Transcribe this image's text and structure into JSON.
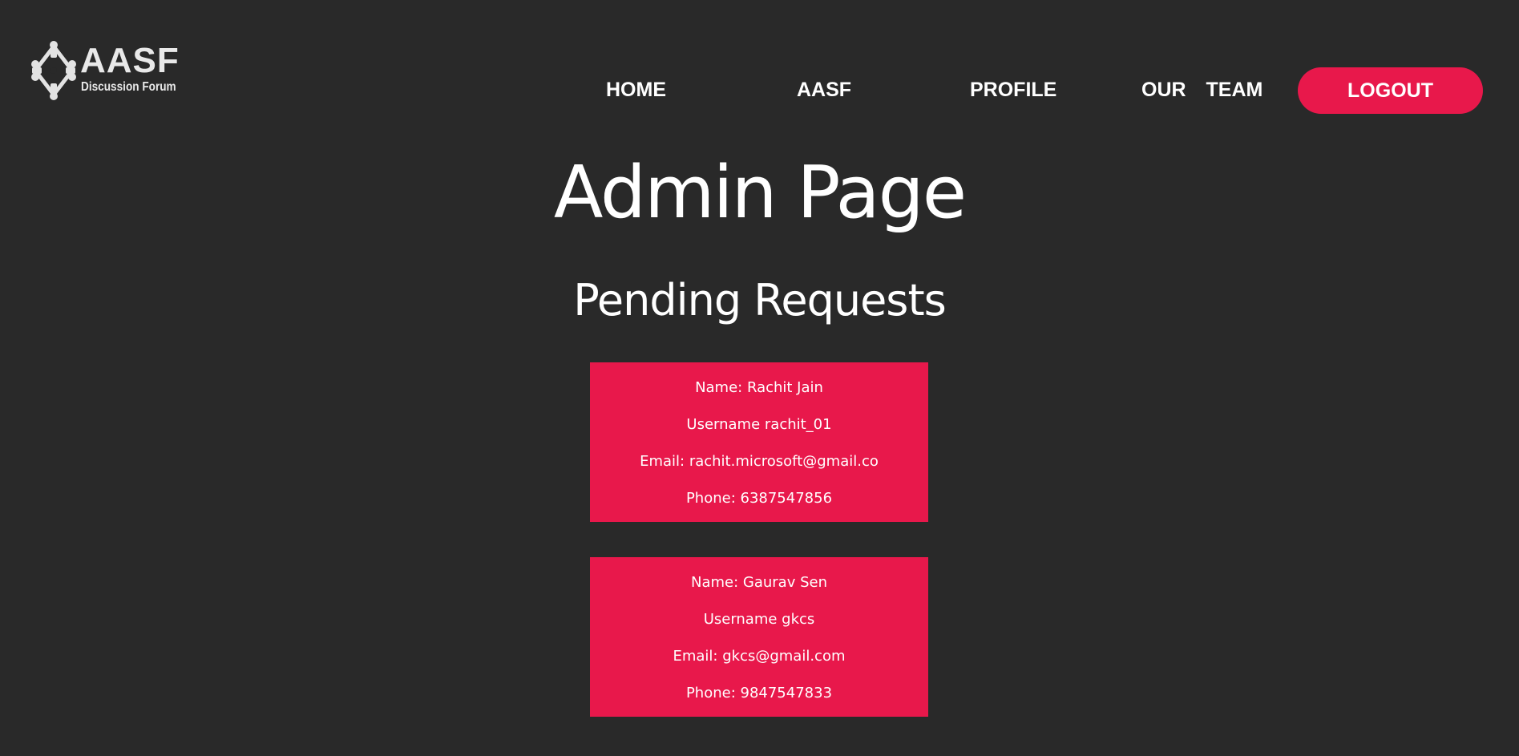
{
  "logo": {
    "title": "AASF",
    "subtitle": "Discussion Forum",
    "icon": "linked-figures-emblem-icon"
  },
  "nav": {
    "items": [
      {
        "label": "HOME"
      },
      {
        "label": "AASF"
      },
      {
        "label": "PROFILE"
      },
      {
        "label": "OUR TEAM"
      }
    ],
    "logout_label": "LOGOUT"
  },
  "page": {
    "title": "Admin Page",
    "section_title": "Pending Requests"
  },
  "requests": [
    {
      "name": "Name: Rachit Jain",
      "username": "Username rachit_01",
      "email": "Email: rachit.microsoft@gmail.co",
      "phone": "Phone: 6387547856"
    },
    {
      "name": "Name: Gaurav Sen",
      "username": "Username gkcs",
      "email": "Email: gkcs@gmail.com",
      "phone": "Phone: 9847547833"
    }
  ],
  "colors": {
    "background": "#292929",
    "accent": "#e8184b",
    "text": "#ffffff"
  }
}
